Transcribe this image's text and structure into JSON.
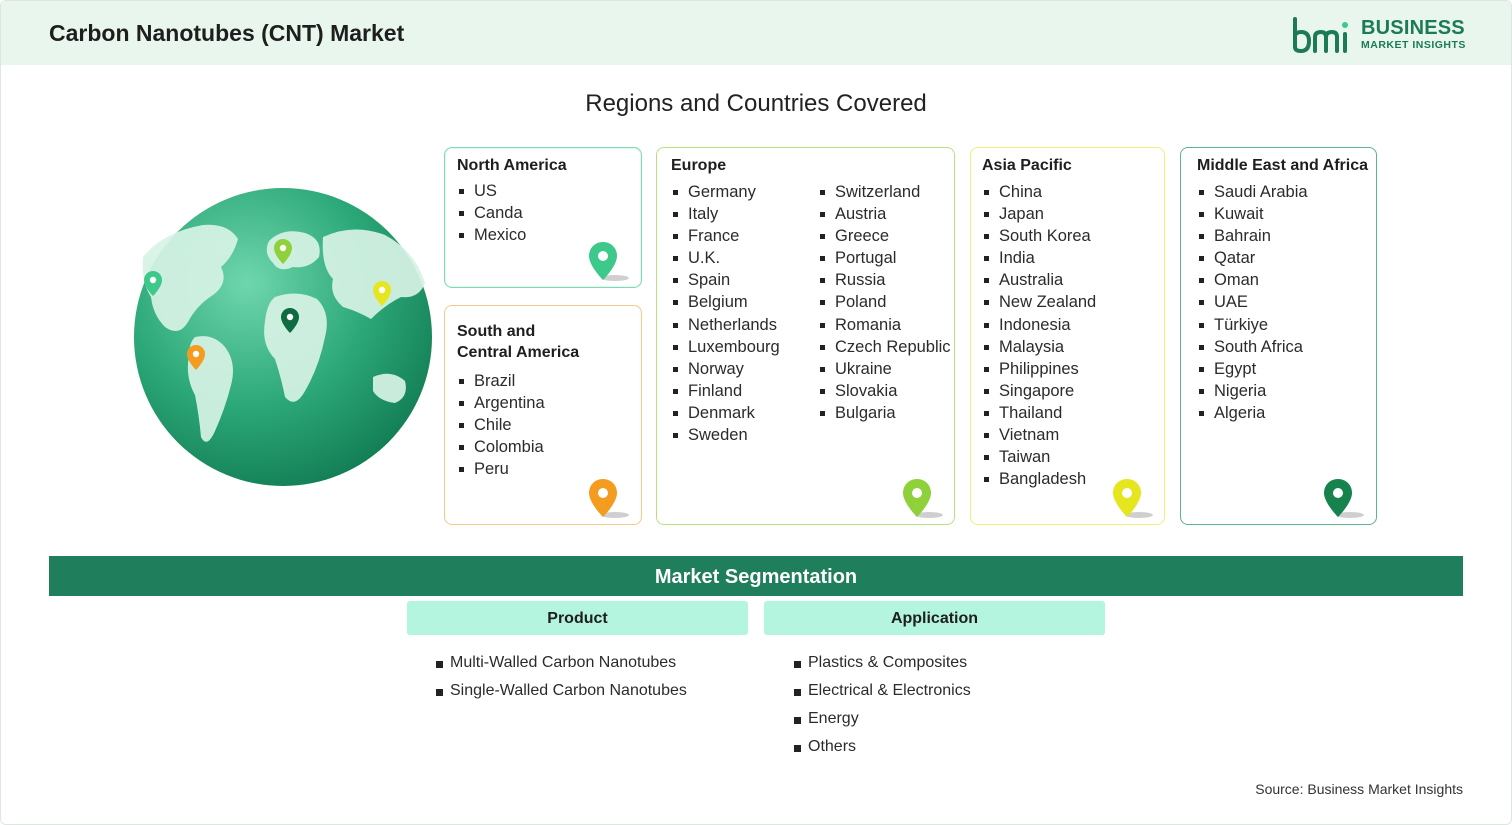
{
  "header": {
    "title": "Carbon Nanotubes (CNT) Market",
    "logo_primary": "BUSINESS",
    "logo_secondary": "MARKET INSIGHTS"
  },
  "regions_title": "Regions and Countries Covered",
  "regions": {
    "north_america": {
      "title": "North America",
      "countries": [
        "US",
        "Canda",
        "Mexico"
      ],
      "pin_color": "#3cc98a"
    },
    "south_central_america": {
      "title_line1": "South and",
      "title_line2": "Central America",
      "countries": [
        "Brazil",
        "Argentina",
        "Chile",
        "Colombia",
        "Peru"
      ],
      "pin_color": "#f39c1f"
    },
    "europe": {
      "title": "Europe",
      "countries_col1": [
        "Germany",
        "Italy",
        "France",
        "U.K.",
        "Spain",
        "Belgium",
        "Netherlands",
        "Luxembourg",
        "Norway",
        "Finland",
        "Denmark",
        "Sweden"
      ],
      "countries_col2": [
        "Switzerland",
        "Austria",
        "Greece",
        "Portugal",
        "Russia",
        "Poland",
        "Romania",
        "Czech Republic",
        "Ukraine",
        "Slovakia",
        "Bulgaria"
      ],
      "pin_color": "#8fd13a"
    },
    "asia_pacific": {
      "title": "Asia Pacific",
      "countries": [
        "China",
        "Japan",
        "South Korea",
        "India",
        "Australia",
        "New Zealand",
        "Indonesia",
        "Malaysia",
        "Philippines",
        "Singapore",
        "Thailand",
        "Vietnam",
        "Taiwan",
        "Bangladesh"
      ],
      "pin_color": "#e6e620"
    },
    "middle_east_africa": {
      "title": "Middle East and Africa",
      "countries": [
        "Saudi Arabia",
        "Kuwait",
        "Bahrain",
        "Qatar",
        "Oman",
        "UAE",
        "Türkiye",
        "South Africa",
        "Egypt",
        "Nigeria",
        "Algeria"
      ],
      "pin_color": "#16824e"
    }
  },
  "segmentation": {
    "title": "Market Segmentation",
    "product": {
      "label": "Product",
      "items": [
        "Multi-Walled Carbon Nanotubes",
        "Single-Walled Carbon Nanotubes"
      ]
    },
    "application": {
      "label": "Application",
      "items": [
        "Plastics & Composites",
        "Electrical & Electronics",
        "Energy",
        "Others"
      ]
    }
  },
  "source": "Source: Business Market Insights",
  "colors": {
    "header_bg": "#e8f6ee",
    "brand_green": "#1f7e5c",
    "segment_head_bg": "#b4f5df"
  }
}
